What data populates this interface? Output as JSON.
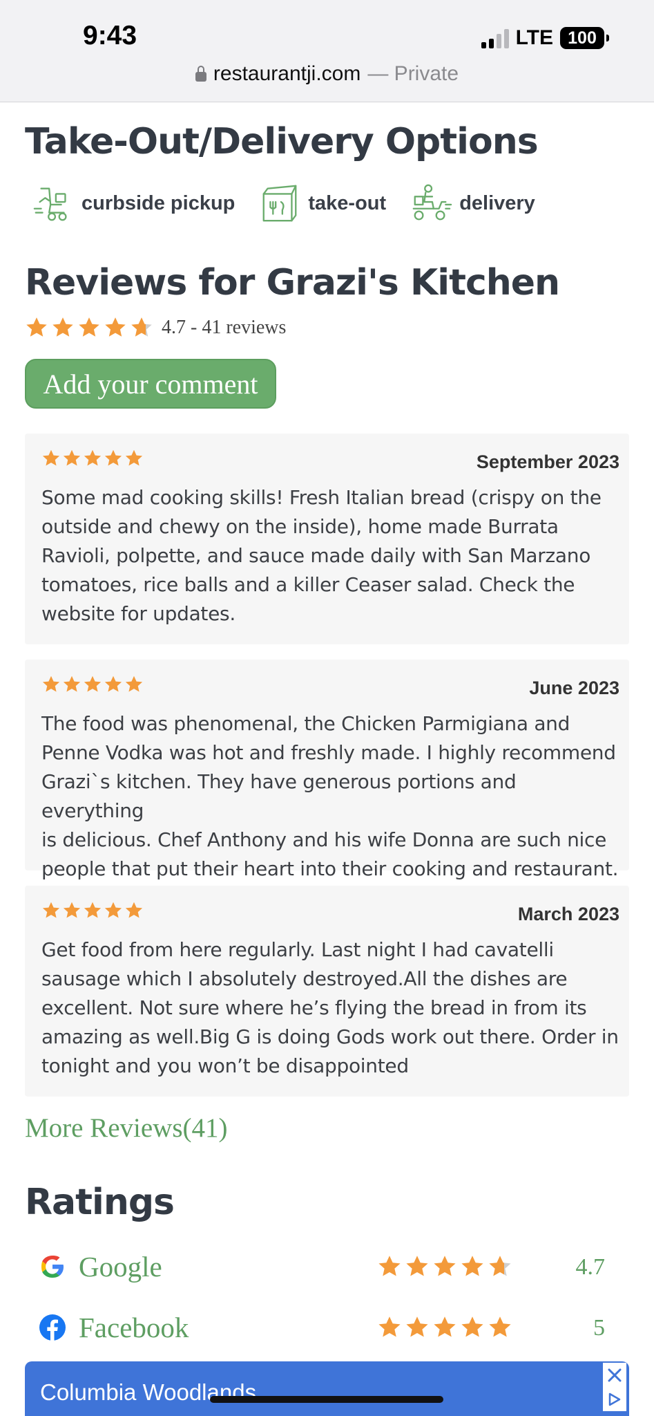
{
  "status_bar": {
    "time": "9:43",
    "network": "LTE",
    "battery": "100"
  },
  "url_bar": {
    "host": "restaurantji.com",
    "suffix": "— Private"
  },
  "takeout": {
    "heading": "Take-Out/Delivery Options",
    "options": [
      {
        "label": "curbside pickup",
        "icon": "curbside-pickup-icon"
      },
      {
        "label": "take-out",
        "icon": "takeout-bag-icon"
      },
      {
        "label": "delivery",
        "icon": "delivery-scooter-icon"
      }
    ]
  },
  "reviews": {
    "heading": "Reviews for Grazi's Kitchen",
    "rating": 4.7,
    "summary": "4.7 - 41 reviews",
    "add_comment": "Add your comment",
    "items": [
      {
        "stars": 5,
        "date": "September 2023",
        "lines": [
          "Some mad cooking skills! Fresh Italian bread (crispy on the",
          "outside and chewy on the inside), home made Burrata",
          "Ravioli, polpette, and sauce made daily with San Marzano",
          "tomatoes, rice balls and a killer Ceaser salad. Check the",
          "website for updates."
        ]
      },
      {
        "stars": 5,
        "date": "June 2023",
        "lines": [
          "The food was phenomenal, the Chicken Parmigiana and",
          "Penne Vodka was hot and freshly made. I highly recommend",
          "Grazi`s kitchen. They have generous portions and everything",
          "is delicious. Chef Anthony and his wife Donna are such nice",
          "people that put their heart into their cooking and restaurant."
        ]
      },
      {
        "stars": 5,
        "date": "March 2023",
        "lines": [
          "Get food from here regularly. Last night I had cavatelli",
          "sausage which I absolutely destroyed.All the dishes are",
          "excellent. Not sure where he’s flying the bread in from its",
          "amazing as well.Big G is doing Gods work out there. Order in",
          "tonight and you won’t be disappointed"
        ]
      }
    ],
    "more_link": "More Reviews(41)"
  },
  "ratings": {
    "heading": "Ratings",
    "items": [
      {
        "source": "Google",
        "value": "4.7",
        "stars": 4.7,
        "icon": "google-logo-icon"
      },
      {
        "source": "Facebook",
        "value": "5",
        "stars": 5,
        "icon": "facebook-logo-icon"
      }
    ]
  },
  "ad": {
    "text": "Columbia Woodlands"
  },
  "colors": {
    "star": "#f39a3a",
    "star_empty": "#cfcfcf",
    "green": "#6aac6c",
    "heading": "#333a44",
    "ad_blue": "#3f74d8"
  }
}
